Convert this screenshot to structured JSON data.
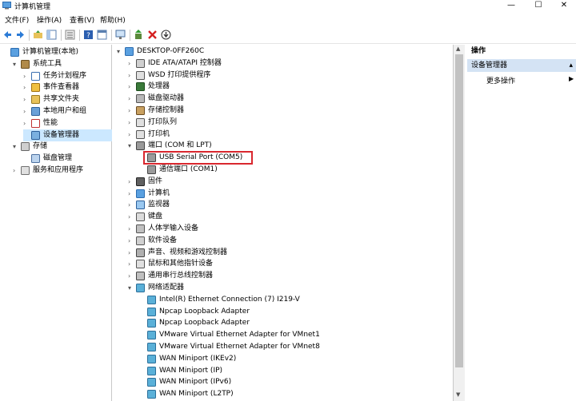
{
  "window": {
    "title": "计算机管理",
    "controls": {
      "minimize": "—",
      "maximize": "☐",
      "close": "✕"
    }
  },
  "menu": [
    "文件(F)",
    "操作(A)",
    "查看(V)",
    "帮助(H)"
  ],
  "toolbar": {
    "icons": [
      "back-icon",
      "forward-icon",
      "up-folder-icon",
      "show-tree-icon",
      "export-list-icon",
      "help-icon",
      "properties-icon",
      "monitor-icon",
      "update-driver-icon",
      "uninstall-icon",
      "download-icon"
    ]
  },
  "left_tree": [
    {
      "label": "计算机管理(本地)",
      "level": 0,
      "expander": "",
      "icon": "computer-mgmt-icon"
    },
    {
      "label": "系统工具",
      "level": 1,
      "expander": "▾",
      "icon": "tools-icon"
    },
    {
      "label": "任务计划程序",
      "level": 2,
      "expander": "›",
      "icon": "task-scheduler-icon"
    },
    {
      "label": "事件查看器",
      "level": 2,
      "expander": "›",
      "icon": "event-viewer-icon"
    },
    {
      "label": "共享文件夹",
      "level": 2,
      "expander": "›",
      "icon": "shared-folder-icon"
    },
    {
      "label": "本地用户和组",
      "level": 2,
      "expander": "›",
      "icon": "users-icon"
    },
    {
      "label": "性能",
      "level": 2,
      "expander": "›",
      "icon": "performance-icon"
    },
    {
      "label": "设备管理器",
      "level": 2,
      "expander": "",
      "icon": "device-manager-icon",
      "selected": true
    },
    {
      "label": "存储",
      "level": 1,
      "expander": "▾",
      "icon": "storage-icon"
    },
    {
      "label": "磁盘管理",
      "level": 2,
      "expander": "",
      "icon": "disk-mgmt-icon"
    },
    {
      "label": "服务和应用程序",
      "level": 1,
      "expander": "›",
      "icon": "services-icon"
    }
  ],
  "device_tree": [
    {
      "label": "DESKTOP-0FF260C",
      "level": 0,
      "expander": "▾",
      "icon": "computer-icon"
    },
    {
      "label": "IDE ATA/ATAPI 控制器",
      "level": 1,
      "expander": "›",
      "icon": "ide-icon"
    },
    {
      "label": "WSD 打印提供程序",
      "level": 1,
      "expander": "›",
      "icon": "printer-icon"
    },
    {
      "label": "处理器",
      "level": 1,
      "expander": "›",
      "icon": "processor-icon"
    },
    {
      "label": "磁盘驱动器",
      "level": 1,
      "expander": "›",
      "icon": "disk-icon"
    },
    {
      "label": "存储控制器",
      "level": 1,
      "expander": "›",
      "icon": "storage-controller-icon"
    },
    {
      "label": "打印队列",
      "level": 1,
      "expander": "›",
      "icon": "print-queue-icon"
    },
    {
      "label": "打印机",
      "level": 1,
      "expander": "›",
      "icon": "printer-icon"
    },
    {
      "label": "端口 (COM 和 LPT)",
      "level": 1,
      "expander": "▾",
      "icon": "port-icon"
    },
    {
      "label": "USB Serial Port (COM5)",
      "level": 2,
      "expander": "",
      "icon": "port-icon",
      "highlight": true
    },
    {
      "label": "通信端口 (COM1)",
      "level": 2,
      "expander": "",
      "icon": "port-icon"
    },
    {
      "label": "固件",
      "level": 1,
      "expander": "›",
      "icon": "firmware-icon"
    },
    {
      "label": "计算机",
      "level": 1,
      "expander": "›",
      "icon": "computer-icon"
    },
    {
      "label": "监视器",
      "level": 1,
      "expander": "›",
      "icon": "monitor-icon"
    },
    {
      "label": "键盘",
      "level": 1,
      "expander": "›",
      "icon": "keyboard-icon"
    },
    {
      "label": "人体学输入设备",
      "level": 1,
      "expander": "›",
      "icon": "hid-icon"
    },
    {
      "label": "软件设备",
      "level": 1,
      "expander": "›",
      "icon": "software-device-icon"
    },
    {
      "label": "声音、视频和游戏控制器",
      "level": 1,
      "expander": "›",
      "icon": "sound-icon"
    },
    {
      "label": "鼠标和其他指针设备",
      "level": 1,
      "expander": "›",
      "icon": "mouse-icon"
    },
    {
      "label": "通用串行总线控制器",
      "level": 1,
      "expander": "›",
      "icon": "usb-icon"
    },
    {
      "label": "网络适配器",
      "level": 1,
      "expander": "▾",
      "icon": "network-icon"
    },
    {
      "label": "Intel(R) Ethernet Connection (7) I219-V",
      "level": 2,
      "expander": "",
      "icon": "network-icon"
    },
    {
      "label": "Npcap Loopback Adapter",
      "level": 2,
      "expander": "",
      "icon": "network-icon"
    },
    {
      "label": "Npcap Loopback Adapter",
      "level": 2,
      "expander": "",
      "icon": "network-icon"
    },
    {
      "label": "VMware Virtual Ethernet Adapter for VMnet1",
      "level": 2,
      "expander": "",
      "icon": "network-icon"
    },
    {
      "label": "VMware Virtual Ethernet Adapter for VMnet8",
      "level": 2,
      "expander": "",
      "icon": "network-icon"
    },
    {
      "label": "WAN Miniport (IKEv2)",
      "level": 2,
      "expander": "",
      "icon": "network-icon"
    },
    {
      "label": "WAN Miniport (IP)",
      "level": 2,
      "expander": "",
      "icon": "network-icon"
    },
    {
      "label": "WAN Miniport (IPv6)",
      "level": 2,
      "expander": "",
      "icon": "network-icon"
    },
    {
      "label": "WAN Miniport (L2TP)",
      "level": 2,
      "expander": "",
      "icon": "network-icon"
    }
  ],
  "actions": {
    "header": "操作",
    "section": "设备管理器",
    "more": "更多操作"
  },
  "colors": {
    "selection": "#cce8ff",
    "highlight_border": "#d9272e",
    "actions_section_bg": "#d4e3f4"
  }
}
